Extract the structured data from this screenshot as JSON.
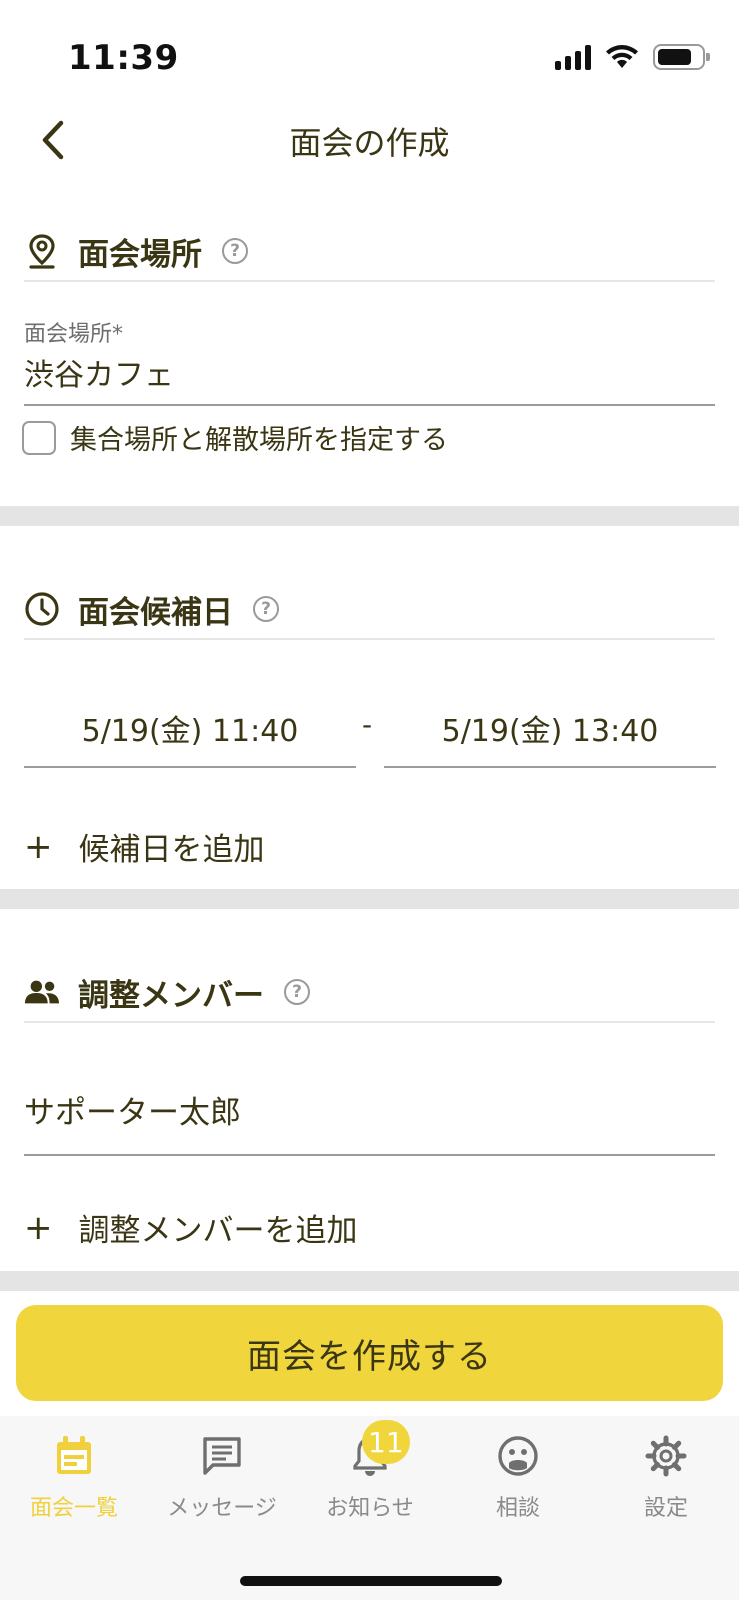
{
  "status": {
    "time": "11:39"
  },
  "nav": {
    "title": "面会の作成"
  },
  "location_section": {
    "title": "面会場所",
    "field_label": "面会場所*",
    "field_value": "渋谷カフェ",
    "checkbox_label": "集合場所と解散場所を指定する",
    "checkbox_checked": false
  },
  "date_section": {
    "title": "面会候補日",
    "start": "5/19(金) 11:40",
    "separator": "-",
    "end": "5/19(金) 13:40",
    "add_label": "候補日を追加"
  },
  "member_section": {
    "title": "調整メンバー",
    "member": "サポーター太郎",
    "add_label": "調整メンバーを追加"
  },
  "help_symbol": "?",
  "add_symbol": "+",
  "primary_button": {
    "label": "面会を作成する"
  },
  "tabs": [
    {
      "label": "面会一覧",
      "icon": "calendar-icon",
      "active": true
    },
    {
      "label": "メッセージ",
      "icon": "message-icon",
      "active": false
    },
    {
      "label": "お知らせ",
      "icon": "bell-icon",
      "active": false,
      "badge": "11"
    },
    {
      "label": "相談",
      "icon": "consult-icon",
      "active": false
    },
    {
      "label": "設定",
      "icon": "gear-icon",
      "active": false
    }
  ],
  "colors": {
    "accent": "#f0d63c",
    "text": "#3a3614",
    "tab_inactive": "#8a8a8a"
  }
}
